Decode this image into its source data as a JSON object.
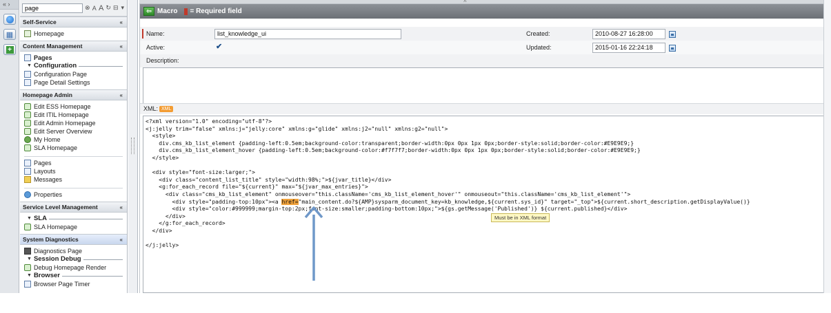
{
  "rail": {
    "top_label": "« ›",
    "icons": [
      "home-circle-icon",
      "grid-icon",
      "add-icon"
    ]
  },
  "navigator": {
    "filter_value": "page",
    "sections": [
      {
        "title": "Self-Service",
        "items": [
          {
            "label": "Homepage",
            "icon": "house-icon"
          }
        ]
      },
      {
        "title": "Content Management",
        "modules": [
          {
            "label": "Pages",
            "type": "item"
          },
          {
            "label": "Configuration",
            "type": "header"
          },
          {
            "label": "Configuration Page",
            "type": "item"
          },
          {
            "label": "Page Detail Settings",
            "type": "item"
          }
        ]
      },
      {
        "title": "Homepage Admin",
        "items": [
          {
            "label": "Edit ESS Homepage"
          },
          {
            "label": "Edit ITIL Homepage"
          },
          {
            "label": "Edit Admin Homepage"
          },
          {
            "label": "Edit Server Overview"
          },
          {
            "label": "My Home"
          },
          {
            "label": "SLA Homepage"
          },
          {
            "label": "Pages"
          },
          {
            "label": "Layouts"
          },
          {
            "label": "Messages"
          },
          {
            "label": "Properties"
          }
        ]
      },
      {
        "title": "Service Level Management",
        "modules": [
          {
            "label": "SLA",
            "type": "header"
          },
          {
            "label": "SLA Homepage",
            "type": "item"
          }
        ]
      },
      {
        "title": "System Diagnostics",
        "modules": [
          {
            "label": "Diagnostics Page",
            "type": "item"
          },
          {
            "label": "Session Debug",
            "type": "header"
          },
          {
            "label": "Debug Homepage Render",
            "type": "item"
          },
          {
            "label": "Browser",
            "type": "header"
          },
          {
            "label": "Browser Page Timer",
            "type": "item"
          }
        ]
      }
    ]
  },
  "form": {
    "title": "Macro",
    "required_legend": "= Required field",
    "name_label": "Name:",
    "name_value": "list_knowledge_ui",
    "active_label": "Active:",
    "active_value": "✔",
    "created_label": "Created:",
    "created_value": "2010-08-27 16:28:00",
    "updated_label": "Updated:",
    "updated_value": "2015-01-16 22:24:18",
    "description_label": "Description:",
    "xml_label": "XML:",
    "xml_badge": "XML",
    "xml_lines": [
      "<?xml version=\"1.0\" encoding=\"utf-8\"?>",
      "<j:jelly trim=\"false\" xmlns:j=\"jelly:core\" xmlns:g=\"glide\" xmlns:j2=\"null\" xmlns:g2=\"null\">",
      "  <style>",
      "    div.cms_kb_list_element {padding-left:0.5em;background-color:transparent;border-width:0px 0px 1px 0px;border-style:solid;border-color:#E9E9E9;}",
      "    div.cms_kb_list_element_hover {padding-left:0.5em;background-color:#f7f7f7;border-width:0px 0px 1px 0px;border-style:solid;border-color:#E9E9E9;}",
      "  </style>",
      "",
      "  <div style=\"font-size:larger;\">",
      "    <div class=\"content_list_title\" style=\"width:98%;\">${jvar_title}</div>",
      "    <g:for_each_record file=\"${current}\" max=\"${jvar_max_entries}\">",
      "      <div class=\"cms_kb_list_element\" onmouseover=\"this.className='cms_kb_list_element_hover'\" onmouseout=\"this.className='cms_kb_list_element'\">",
      "        <div style=\"padding-top:10px\"><a ",
      "        <div style=\"color:#999999;margin-top:2px;font-size:smaller;padding-bottom:10px;\">${gs.getMessage('Published')} ${current.published}</div>",
      "      </div>",
      "    </g:for_each_record>",
      "  </div>",
      "",
      "</j:jelly>"
    ],
    "highlight_token": "href=",
    "line12_tail": "\"main_content.do?${AMP}sysparm_document_key=kb_knowledge,${current.sys_id}\" target=\"_top\">${current.short_description.getDisplayValue()}",
    "tooltip": "Must be in XML format"
  },
  "colors": {
    "header": "#7b7f85",
    "required": "#c0392b",
    "highlight": "#f1a33c",
    "arrow": "#6f98c9"
  }
}
